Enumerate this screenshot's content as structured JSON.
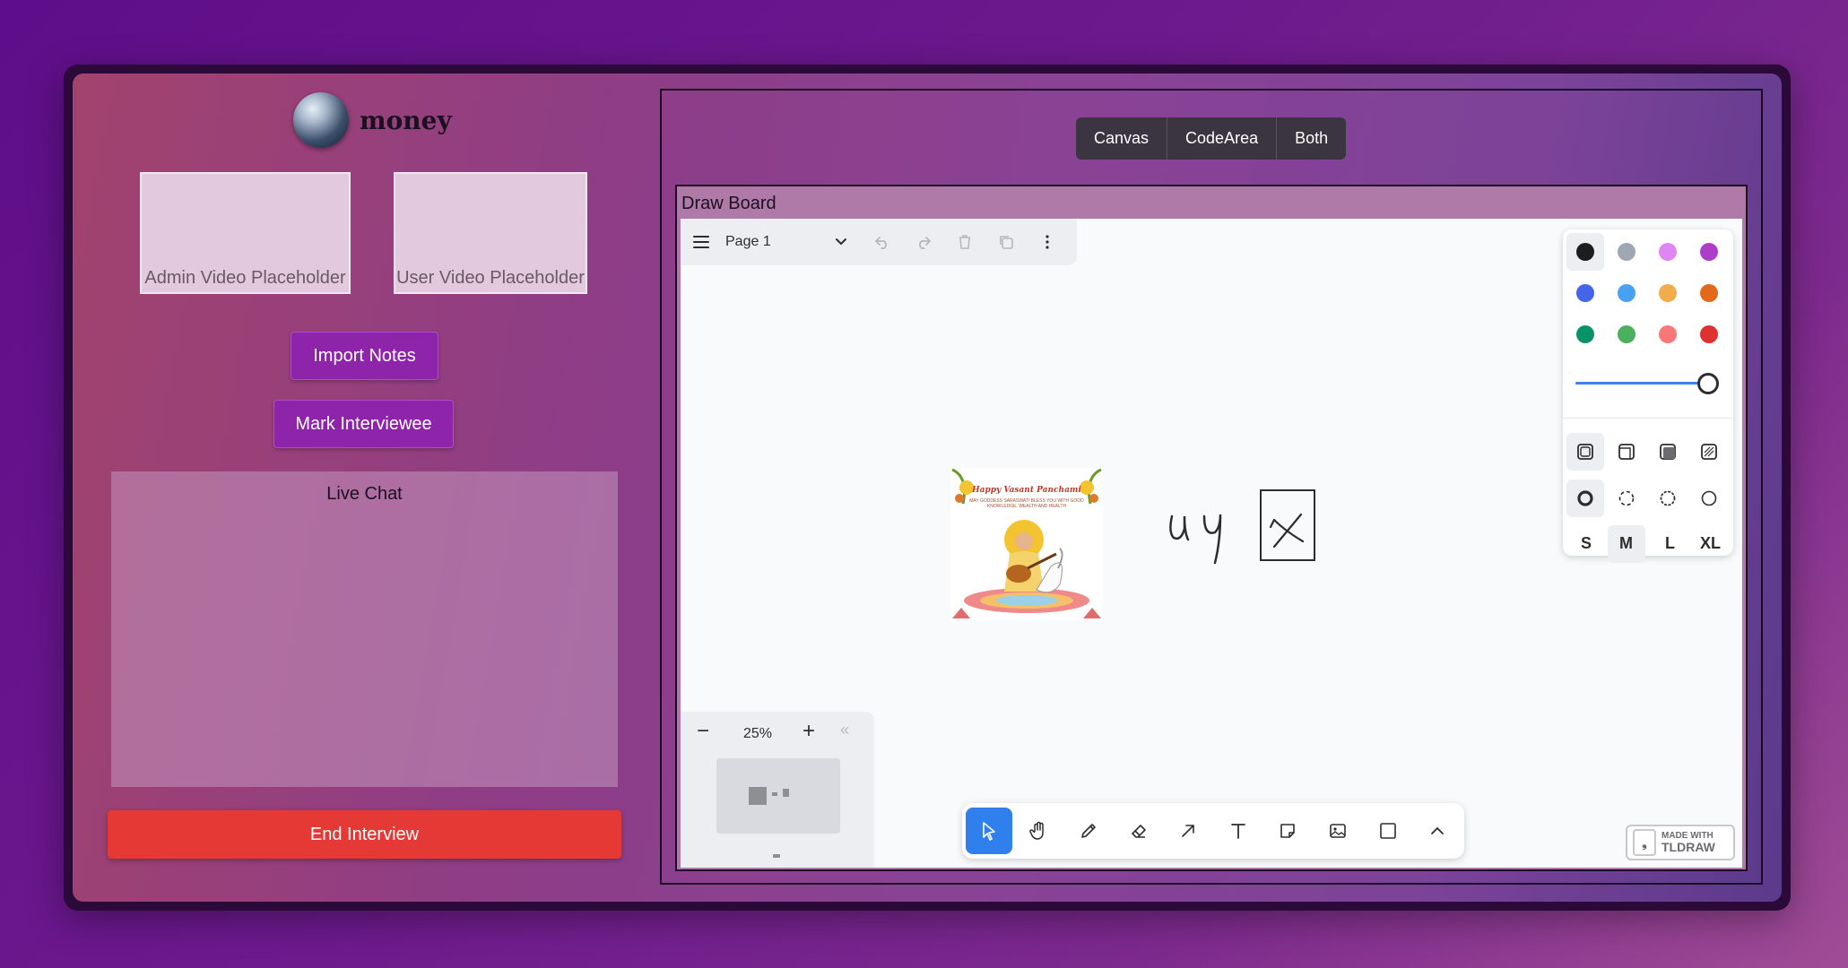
{
  "brand": {
    "name": "money"
  },
  "video": {
    "admin": "Admin Video Placeholder",
    "user": "User Video Placeholder"
  },
  "actions": {
    "import_notes": "Import Notes",
    "mark_interviewee": "Mark Interviewee",
    "end_interview": "End Interview"
  },
  "live_chat": {
    "title": "Live Chat"
  },
  "view_toggle": {
    "canvas": "Canvas",
    "codearea": "CodeArea",
    "both": "Both"
  },
  "board": {
    "title": "Draw Board",
    "page_name": "Page 1",
    "zoom": "25%",
    "card_title": "Happy Vasant Panchami",
    "card_subtitle": "MAY GODDESS SARASWATI BLESS YOU WITH GOOD KNOWLEDGE, WEALTH AND HEALTH",
    "handwriting": "u y"
  },
  "style_panel": {
    "colors": [
      "#1d1d1d",
      "#9fa8b2",
      "#e085f4",
      "#ae3ec9",
      "#4465e9",
      "#4ba1f1",
      "#f1ac4b",
      "#e16919",
      "#099268",
      "#4cb05e",
      "#f87777",
      "#e03131"
    ],
    "selected_color": "#1d1d1d",
    "sizes": [
      "S",
      "M",
      "L",
      "XL"
    ],
    "selected_size": "M"
  },
  "watermark": {
    "line1": "MADE WITH",
    "line2": "TLDRAW"
  },
  "accent": {
    "purple": "#8e24aa",
    "danger": "#e53935",
    "tool_active": "#2f80ed"
  }
}
